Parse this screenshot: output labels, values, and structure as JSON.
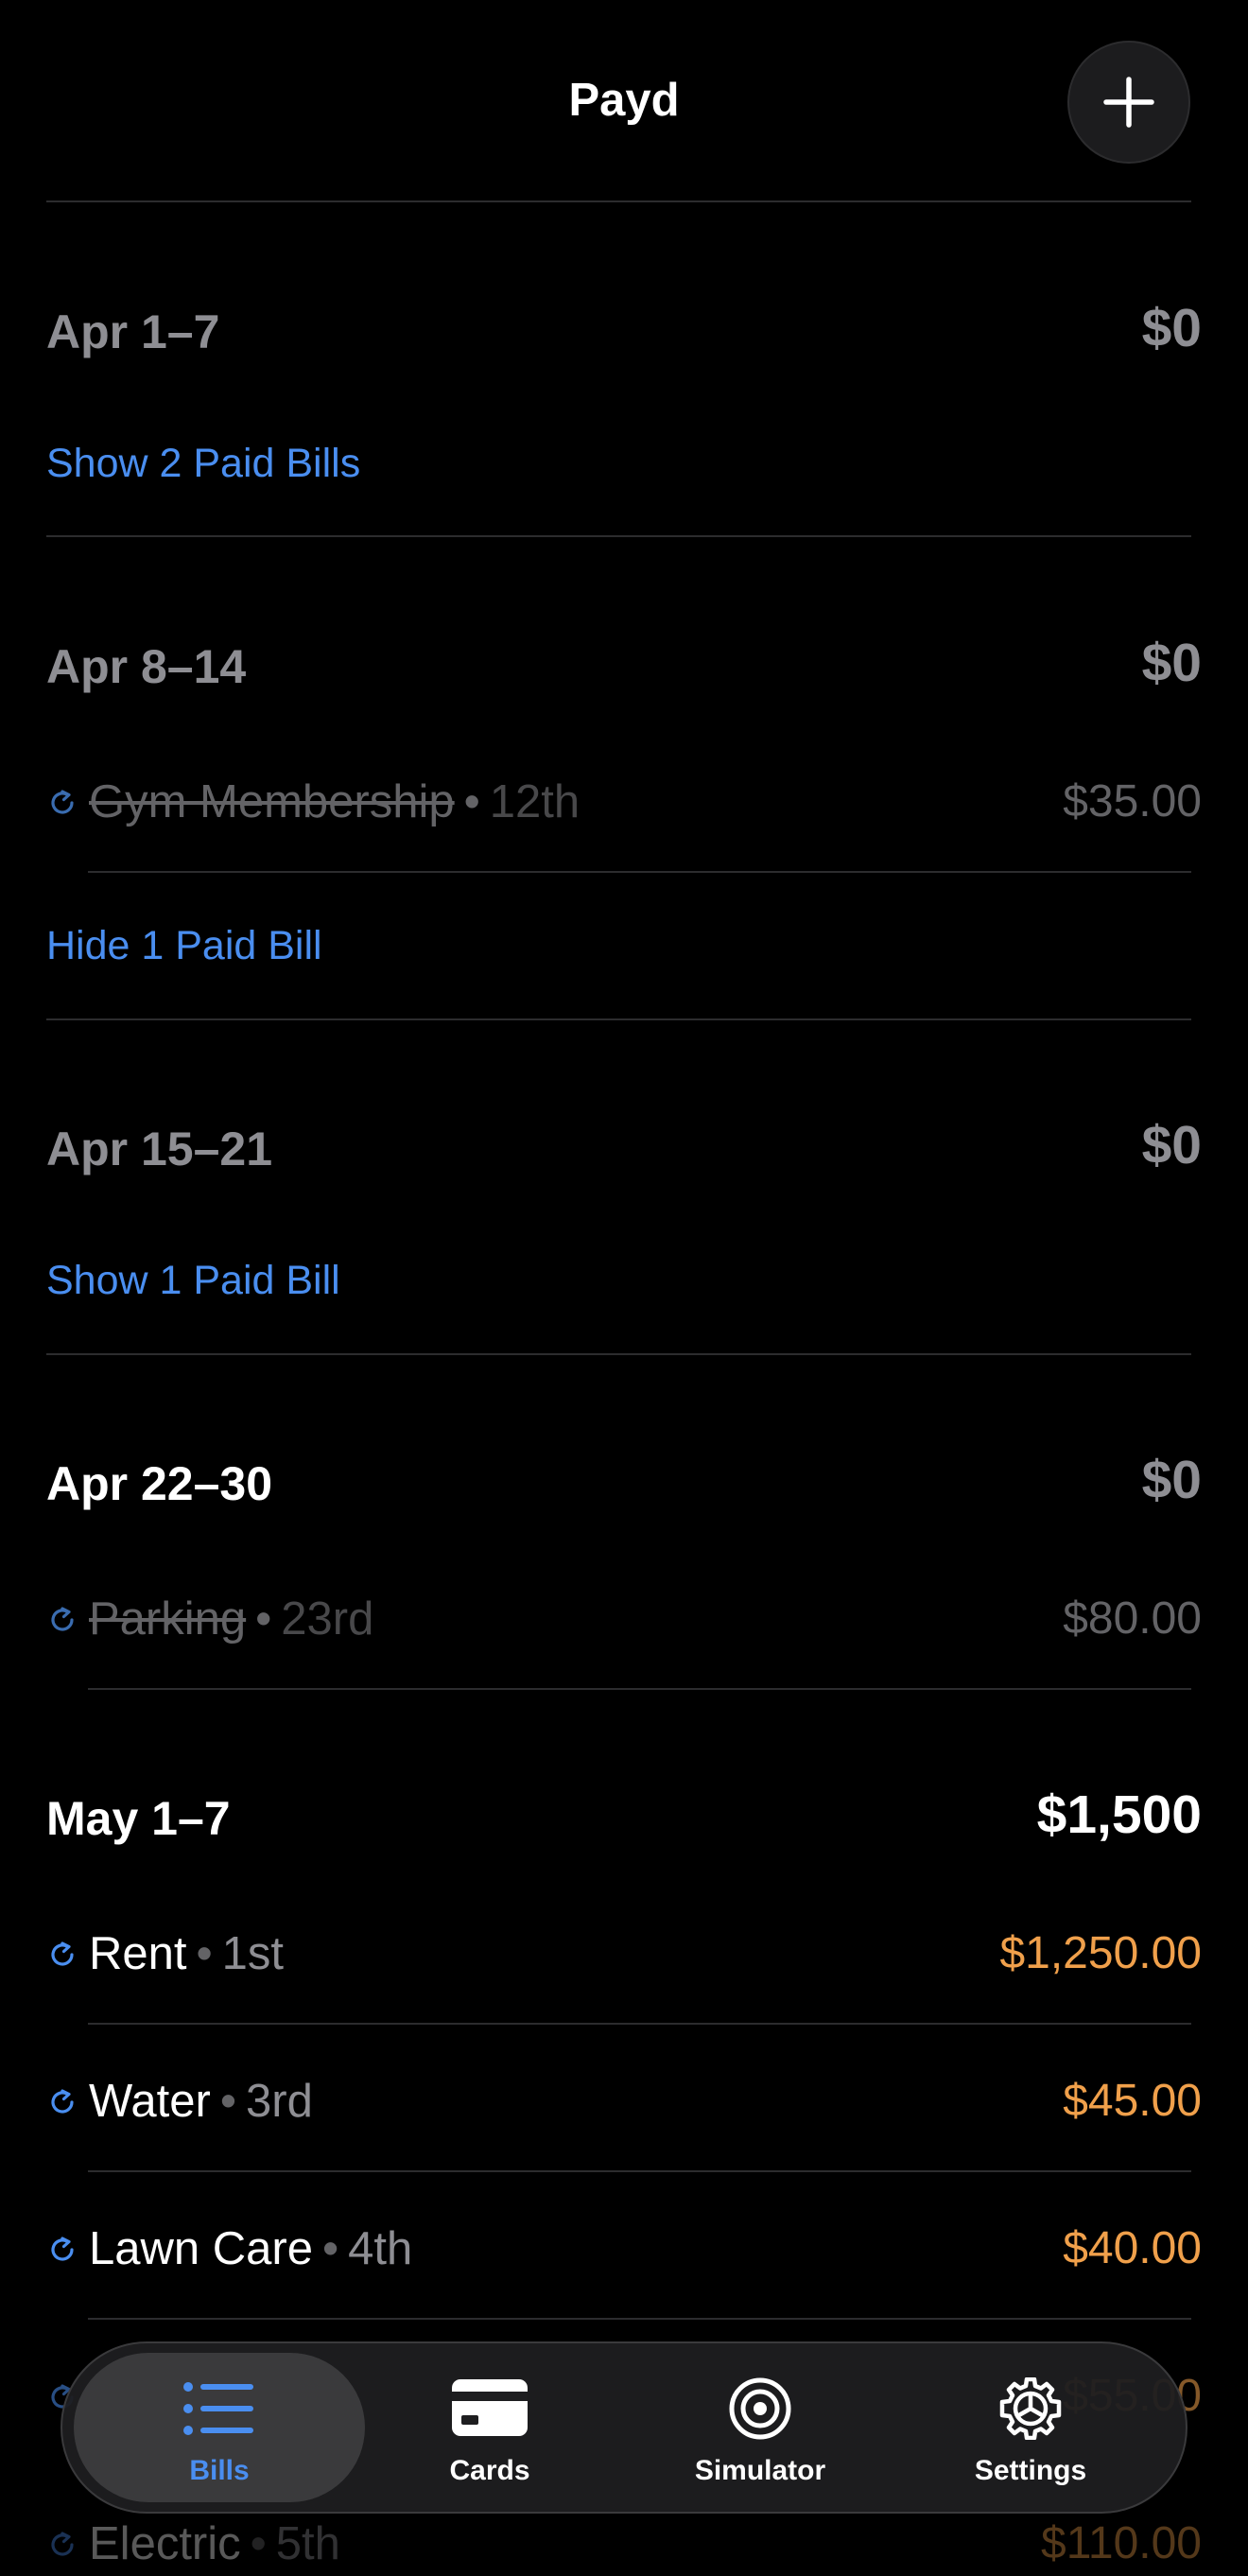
{
  "app": {
    "title": "Payd"
  },
  "weeks": [
    {
      "label": "Apr 1–7",
      "total": "$0",
      "toggle": "Show 2 Paid Bills"
    },
    {
      "label": "Apr 8–14",
      "total": "$0",
      "toggle": "Hide 1 Paid Bill",
      "bills": [
        {
          "name": "Gym Membership",
          "due": "12th",
          "amount": "$35.00",
          "paid": true
        }
      ]
    },
    {
      "label": "Apr 15–21",
      "total": "$0",
      "toggle": "Show 1 Paid Bill"
    },
    {
      "label": "Apr 22–30",
      "total": "$0",
      "bills": [
        {
          "name": "Parking",
          "due": "23rd",
          "amount": "$80.00",
          "paid": true
        }
      ]
    },
    {
      "label": "May 1–7",
      "total": "$1,500",
      "bills": [
        {
          "name": "Rent",
          "due": "1st",
          "amount": "$1,250.00",
          "paid": false
        },
        {
          "name": "Water",
          "due": "3rd",
          "amount": "$45.00",
          "paid": false
        },
        {
          "name": "Lawn Care",
          "due": "4th",
          "amount": "$40.00",
          "paid": false
        },
        {
          "name": "",
          "due": "",
          "amount": "$55.00",
          "paid": false
        },
        {
          "name": "Electric",
          "due": "5th",
          "amount": "$110.00",
          "paid": false
        }
      ]
    }
  ],
  "tabbar": {
    "tabs": [
      {
        "label": "Bills",
        "icon": "list-icon",
        "selected": true
      },
      {
        "label": "Cards",
        "icon": "card-icon",
        "selected": false
      },
      {
        "label": "Simulator",
        "icon": "target-icon",
        "selected": false
      },
      {
        "label": "Settings",
        "icon": "gear-icon",
        "selected": false
      }
    ]
  },
  "colors": {
    "accent": "#4a8ef0",
    "due_amount": "#f0a04b",
    "muted": "#8e8e93",
    "background": "#000000"
  }
}
